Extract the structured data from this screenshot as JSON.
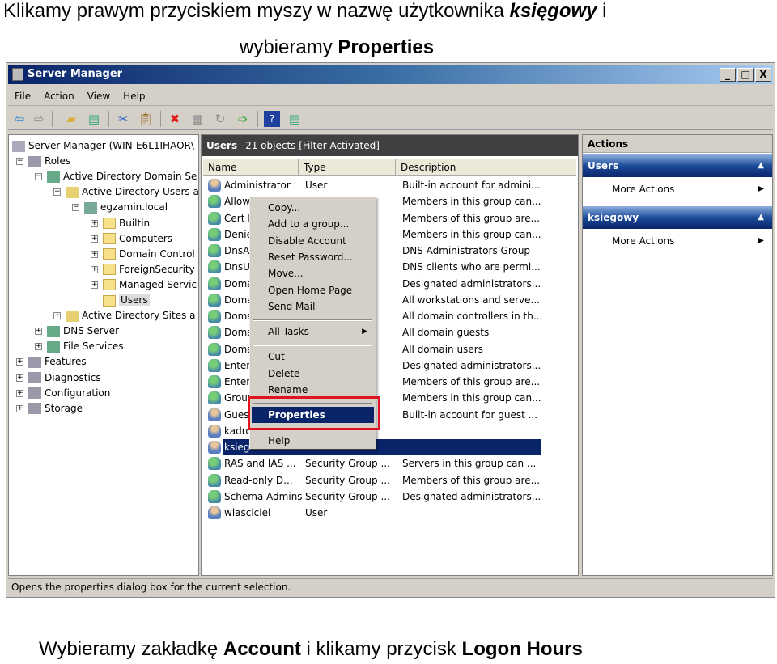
{
  "captions": {
    "top1_a": "Klikamy prawym przyciskiem myszy w nazwę użytkownika ",
    "top1_b": "księgowy",
    "top1_c": " i",
    "top2_a": "wybieramy ",
    "top2_b": "Properties",
    "bottom_a": "Wybieramy zakładkę ",
    "bottom_b": "Account",
    "bottom_c": " i klikamy przycisk ",
    "bottom_d": "Logon Hours"
  },
  "window": {
    "title": "Server Manager",
    "controls": [
      "_",
      "□",
      "X"
    ]
  },
  "menu": [
    "File",
    "Action",
    "View",
    "Help"
  ],
  "toolbar": [
    "back-icon",
    "forward-icon",
    "up-folder-icon",
    "show-hide-tree-icon",
    "cut-icon",
    "paste-icon",
    "delete-icon",
    "properties-icon",
    "refresh-icon",
    "export-icon",
    "help-icon",
    "show-hide-action-icon"
  ],
  "tree": [
    {
      "label": "Server Manager (WIN-E6L1IHAOR\\",
      "level": 0,
      "exp": ""
    },
    {
      "label": "Roles",
      "level": 1,
      "exp": "−"
    },
    {
      "label": "Active Directory Domain Se",
      "level": 2,
      "exp": "−"
    },
    {
      "label": "Active Directory Users a",
      "level": 3,
      "exp": "−"
    },
    {
      "label": "egzamin.local",
      "level": 4,
      "exp": "−"
    },
    {
      "label": "Builtin",
      "level": 5,
      "exp": "+"
    },
    {
      "label": "Computers",
      "level": 5,
      "exp": "+"
    },
    {
      "label": "Domain Control",
      "level": 5,
      "exp": "+"
    },
    {
      "label": "ForeignSecurity",
      "level": 5,
      "exp": "+"
    },
    {
      "label": "Managed Servic",
      "level": 5,
      "exp": "+"
    },
    {
      "label": "Users",
      "level": 5,
      "exp": "",
      "selected": true
    },
    {
      "label": "Active Directory Sites a",
      "level": 3,
      "exp": "+"
    },
    {
      "label": "DNS Server",
      "level": 2,
      "exp": "+"
    },
    {
      "label": "File Services",
      "level": 2,
      "exp": "+"
    },
    {
      "label": "Features",
      "level": 1,
      "exp": "+"
    },
    {
      "label": "Diagnostics",
      "level": 1,
      "exp": "+"
    },
    {
      "label": "Configuration",
      "level": 1,
      "exp": "+"
    },
    {
      "label": "Storage",
      "level": 1,
      "exp": "+"
    }
  ],
  "center": {
    "title": "Users",
    "count": "21 objects",
    "filter": "[Filter Activated]",
    "columns": [
      "Name",
      "Type",
      "Description"
    ],
    "rows": [
      {
        "name": "Administrator",
        "type": "User",
        "desc": "Built-in account for admini...",
        "kind": "user"
      },
      {
        "name": "Allowe",
        "type": "...",
        "desc": "Members in this group can...",
        "kind": "group"
      },
      {
        "name": "Cert P",
        "type": "...",
        "desc": "Members of this group are...",
        "kind": "group"
      },
      {
        "name": "Denie",
        "type": "...",
        "desc": "Members in this group can...",
        "kind": "group"
      },
      {
        "name": "DnsAd",
        "type": "...",
        "desc": "DNS Administrators Group",
        "kind": "group"
      },
      {
        "name": "DnsUp",
        "type": "...",
        "desc": "DNS clients who are permi...",
        "kind": "group"
      },
      {
        "name": "Doma",
        "type": "...",
        "desc": "Designated administrators...",
        "kind": "group"
      },
      {
        "name": "Doma",
        "type": "...",
        "desc": "All workstations and serve...",
        "kind": "group"
      },
      {
        "name": "Doma",
        "type": "...",
        "desc": "All domain controllers in th...",
        "kind": "group"
      },
      {
        "name": "Doma",
        "type": "...",
        "desc": "All domain guests",
        "kind": "group"
      },
      {
        "name": "Doma",
        "type": "...",
        "desc": "All domain users",
        "kind": "group"
      },
      {
        "name": "Enterp",
        "type": "...",
        "desc": "Designated administrators...",
        "kind": "group"
      },
      {
        "name": "Enterp",
        "type": "...",
        "desc": "Members of this group are...",
        "kind": "group"
      },
      {
        "name": "Group",
        "type": "...",
        "desc": "Members in this group can...",
        "kind": "group"
      },
      {
        "name": "Guest",
        "type": "",
        "desc": "Built-in account for guest ...",
        "kind": "user"
      },
      {
        "name": "kadro",
        "type": "",
        "desc": "",
        "kind": "user"
      },
      {
        "name": "ksiego",
        "type": "",
        "desc": "",
        "kind": "user",
        "selected": true
      },
      {
        "name": "RAS and IAS ...",
        "type": "Security Group ...",
        "desc": "Servers in this group can ...",
        "kind": "group"
      },
      {
        "name": "Read-only D...",
        "type": "Security Group ...",
        "desc": "Members of this group are...",
        "kind": "group"
      },
      {
        "name": "Schema Admins",
        "type": "Security Group ...",
        "desc": "Designated administrators...",
        "kind": "group"
      },
      {
        "name": "wlasciciel",
        "type": "User",
        "desc": "",
        "kind": "user"
      }
    ]
  },
  "context_menu": [
    {
      "label": "Copy..."
    },
    {
      "label": "Add to a group..."
    },
    {
      "label": "Disable Account"
    },
    {
      "label": "Reset Password..."
    },
    {
      "label": "Move..."
    },
    {
      "label": "Open Home Page"
    },
    {
      "label": "Send Mail"
    },
    {
      "sep": true
    },
    {
      "label": "All Tasks",
      "submenu": true
    },
    {
      "sep": true
    },
    {
      "label": "Cut"
    },
    {
      "label": "Delete"
    },
    {
      "label": "Rename"
    },
    {
      "sep": true
    },
    {
      "label": "Properties",
      "highlighted": true
    },
    {
      "sep": true
    },
    {
      "label": "Help"
    }
  ],
  "actions": {
    "title": "Actions",
    "sections": [
      {
        "title": "Users",
        "items": [
          "More Actions"
        ]
      },
      {
        "title": "ksiegowy",
        "items": [
          "More Actions"
        ]
      }
    ]
  },
  "status": "Opens the properties dialog box for the current selection.",
  "colors": {
    "highlight": "#0a246a",
    "annotation": "#e0141e",
    "title_bar": "#0a246a"
  }
}
